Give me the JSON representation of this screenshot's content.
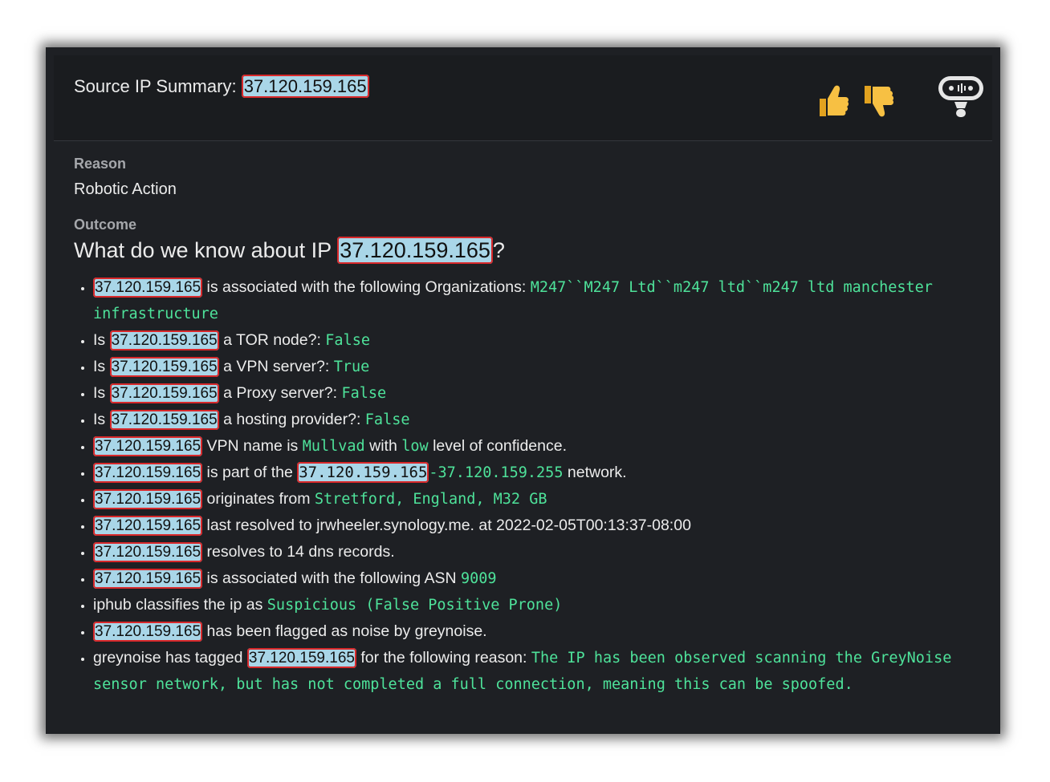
{
  "header": {
    "title_prefix": "Source IP Summary:",
    "ip": "37.120.159.165",
    "thumbs_up_icon": "thumbs-up-icon",
    "thumbs_down_icon": "thumbs-down-icon",
    "bot_icon": "robot-icon"
  },
  "reason": {
    "label": "Reason",
    "value": "Robotic Action"
  },
  "outcome": {
    "label": "Outcome",
    "question_prefix": "What do we know about IP",
    "question_suffix": "?"
  },
  "colors": {
    "background": "#1e2024",
    "ip_highlight": "#a9d6e8",
    "ip_border": "#d8282a",
    "code_green": "#4ee29a",
    "thumb": "#f5b52e"
  },
  "facts": {
    "f1": {
      "text": "is associated with the following Organizations:",
      "code": "M247``M247 Ltd``m247 ltd``m247 ltd manchester infrastructure"
    },
    "f2": {
      "pre": "Is",
      "text": "a TOR node?:",
      "code": "False"
    },
    "f3": {
      "pre": "Is",
      "text": "a VPN server?:",
      "code": "True"
    },
    "f4": {
      "pre": "Is",
      "text": "a Proxy server?:",
      "code": "False"
    },
    "f5": {
      "pre": "Is",
      "text": "a hosting provider?:",
      "code": "False"
    },
    "f6": {
      "text1": "VPN name is",
      "code1": "Mullvad",
      "text2": "with",
      "code2": "low",
      "text3": "level of confidence."
    },
    "f7": {
      "text1": "is part of the",
      "code_ip": "37.120.159.165",
      "code_range": "-37.120.159.255",
      "text2": "network."
    },
    "f8": {
      "text": "originates from",
      "code": "Stretford, England, M32 GB"
    },
    "f9": {
      "text": "last resolved to jrwheeler.synology.me. at 2022-02-05T00:13:37-08:00"
    },
    "f10": {
      "text": "resolves to 14 dns records."
    },
    "f11": {
      "text": "is associated with the following ASN",
      "code": "9009"
    },
    "f12": {
      "text": "iphub classifies the ip as",
      "code": "Suspicious (False Positive Prone)"
    },
    "f13": {
      "text": "has been flagged as noise by greynoise."
    },
    "f14": {
      "pre": "greynoise has tagged",
      "text": "for the following reason:",
      "code": "The IP has been observed scanning the GreyNoise sensor network, but has not completed a full connection, meaning this can be spoofed."
    }
  }
}
